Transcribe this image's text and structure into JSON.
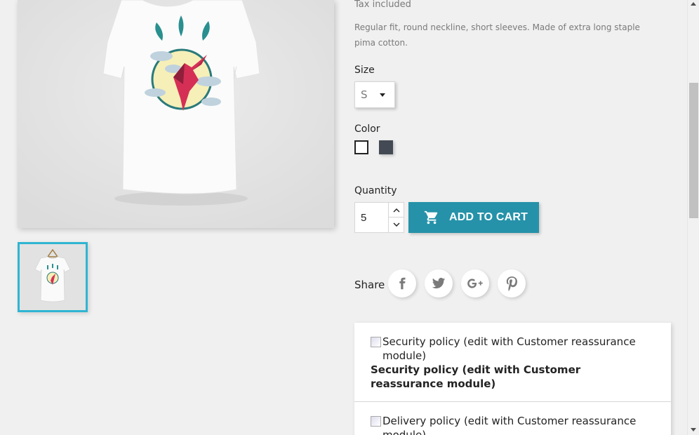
{
  "product": {
    "tax_text": "Tax included",
    "description": "Regular fit, round neckline, short sleeves. Made of extra long staple pima cotton.",
    "main_image_icon": "tshirt-hummingbird-image",
    "thumbnail_icon": "tshirt-hanger-thumbnail"
  },
  "variants": {
    "size_label": "Size",
    "size_selected": "S",
    "color_label": "Color",
    "colors": [
      {
        "name": "White",
        "hex": "#ffffff",
        "selected": true
      },
      {
        "name": "Grey",
        "hex": "#434a54",
        "selected": false
      }
    ]
  },
  "cart": {
    "quantity_label": "Quantity",
    "quantity_value": "5",
    "add_to_cart_label": "ADD TO CART",
    "button_color": "#2592a9"
  },
  "share": {
    "label": "Share",
    "networks": [
      "facebook-icon",
      "twitter-icon",
      "google-plus-icon",
      "pinterest-icon"
    ]
  },
  "reassurance": {
    "items": [
      {
        "alt": "Security policy (edit with Customer reassurance module)",
        "title": "Security policy (edit with Customer reassurance module)"
      },
      {
        "alt": "Delivery policy (edit with Customer reassurance module)"
      }
    ]
  },
  "colors": {
    "accent": "#2fb5d2",
    "background": "#f0f0f0",
    "muted_text": "#7a7a7a"
  }
}
